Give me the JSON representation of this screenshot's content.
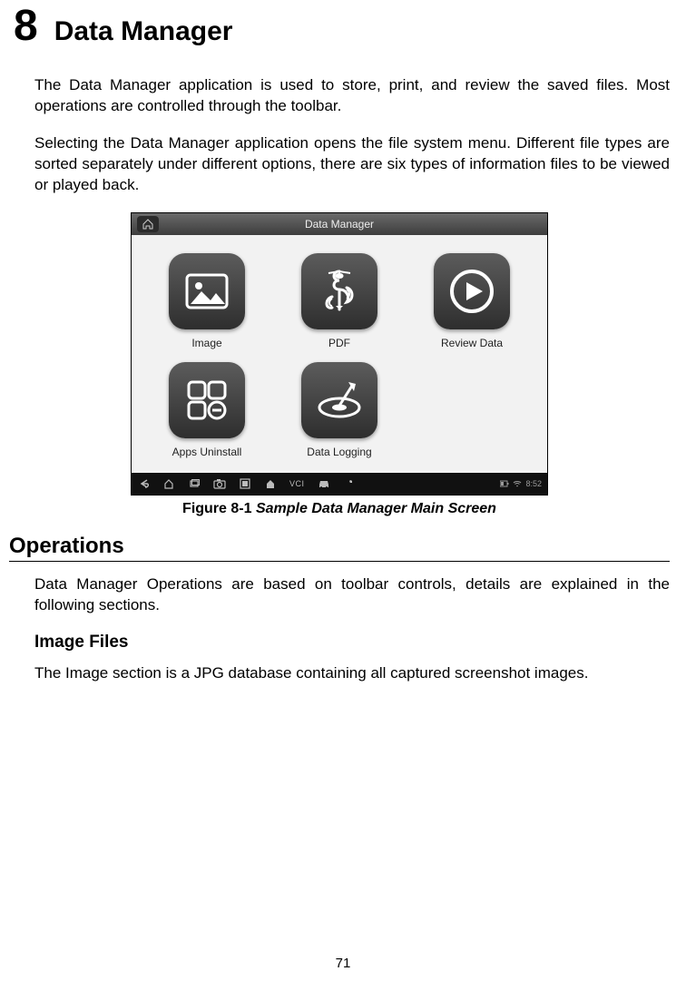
{
  "chapter": {
    "number": "8",
    "title": "Data Manager"
  },
  "paragraphs": {
    "p1": "The Data Manager application is used to store, print, and review the saved files. Most operations are controlled through the toolbar.",
    "p2": "Selecting the Data Manager application opens the file system menu. Different file types are sorted separately under different options, there are six types of information files to be viewed or played back.",
    "p3": "Data Manager Operations are based on toolbar controls, details are explained in the following sections.",
    "p4": "The Image section is a JPG database containing all captured screenshot images."
  },
  "figure": {
    "label_prefix": "Figure 8-1 ",
    "label_italic": "Sample Data Manager Main Screen"
  },
  "sections": {
    "operations": "Operations",
    "image_files": "Image Files"
  },
  "device": {
    "topbar_title": "Data Manager",
    "tiles": [
      {
        "label": "Image"
      },
      {
        "label": "PDF"
      },
      {
        "label": "Review Data"
      },
      {
        "label": "Apps Uninstall"
      },
      {
        "label": "Data Logging"
      }
    ],
    "bottombar_vci": "VCI",
    "clock": "8:52"
  },
  "page_number": "71"
}
